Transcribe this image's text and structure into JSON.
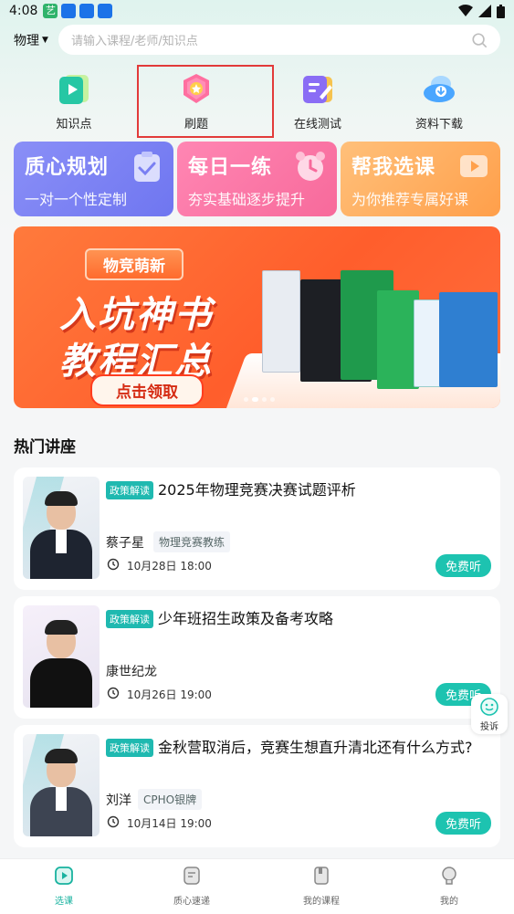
{
  "status_bar": {
    "time": "4:08"
  },
  "header": {
    "subject": "物理",
    "search_placeholder": "请输入课程/老师/知识点"
  },
  "quick_nav": [
    {
      "label": "知识点",
      "icon": "knowledge-icon"
    },
    {
      "label": "刷题",
      "icon": "medal-icon"
    },
    {
      "label": "在线测试",
      "icon": "test-icon"
    },
    {
      "label": "资料下载",
      "icon": "cloud-download-icon"
    }
  ],
  "feature_cards": [
    {
      "title": "质心规划",
      "subtitle": "一对一个性定制",
      "color": "#7b80f3"
    },
    {
      "title": "每日一练",
      "subtitle": "夯实基础逐步提升",
      "color": "#f976a3"
    },
    {
      "title": "帮我选课",
      "subtitle": "为你推荐专属好课",
      "color": "#ffab5a"
    }
  ],
  "banner": {
    "tagline": "物竞萌新",
    "headline_1": "入坑神书",
    "headline_2": "教程汇总",
    "cta": "点击领取"
  },
  "section": {
    "title": "热门讲座"
  },
  "lectures": [
    {
      "tag": "政策解读",
      "title": "2025年物理竞赛决赛试题评析",
      "teacher": "蔡子星",
      "role": "物理竞赛教练",
      "time": "10月28日 18:00",
      "button": "免费听"
    },
    {
      "tag": "政策解读",
      "title": "少年班招生政策及备考攻略",
      "teacher": "康世纪龙",
      "role": "",
      "time": "10月26日 19:00",
      "button": "免费听"
    },
    {
      "tag": "政策解读",
      "title": "金秋营取消后，竞赛生想直升清北还有什么方式?",
      "teacher": "刘洋",
      "role": "CPHO银牌",
      "time": "10月14日 19:00",
      "button": "免费听"
    }
  ],
  "complaint": {
    "label": "投诉"
  },
  "bottom_nav": [
    {
      "label": "选课",
      "active": true
    },
    {
      "label": "质心速递",
      "active": false
    },
    {
      "label": "我的课程",
      "active": false
    },
    {
      "label": "我的",
      "active": false
    }
  ],
  "colors": {
    "accent": "#1dc3b0",
    "highlight": "#e23a3a"
  }
}
